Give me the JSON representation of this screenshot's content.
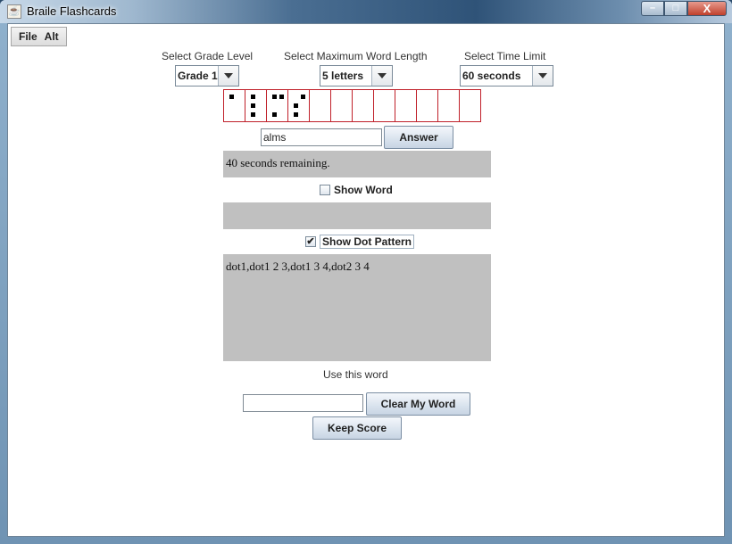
{
  "window": {
    "title": "Braile Flashcards",
    "controls": {
      "minimize": "–",
      "maximize": "□",
      "close": "X"
    }
  },
  "menu": [
    {
      "label": "File"
    },
    {
      "label": "Alt"
    }
  ],
  "options": {
    "grade": {
      "label": "Select Grade Level",
      "value": "Grade 1"
    },
    "word_length": {
      "label": "Select Maximum Word Length",
      "value": "5 letters"
    },
    "time_limit": {
      "label": "Select Time Limit",
      "value": "60 seconds"
    }
  },
  "braille": {
    "cell_count": 12,
    "cells": [
      {
        "dots": [
          1
        ]
      },
      {
        "dots": [
          1,
          2,
          3
        ]
      },
      {
        "dots": [
          1,
          3,
          4
        ]
      },
      {
        "dots": [
          2,
          3,
          4
        ]
      }
    ]
  },
  "answer": {
    "input_value": "alms",
    "button_label": "Answer"
  },
  "status": {
    "text": "40 seconds remaining."
  },
  "show_word": {
    "label": "Show Word",
    "checked": false,
    "word_text": ""
  },
  "show_dot_pattern": {
    "label": "Show Dot Pattern",
    "checked": true,
    "pattern_text": "dot1,dot1 2 3,dot1 3 4,dot2 3 4"
  },
  "use_word": {
    "label": "Use this word",
    "input_value": "",
    "clear_button_label": "Clear My Word"
  },
  "keep_score": {
    "button_label": "Keep Score"
  },
  "icons": {
    "app": "java-cup-icon",
    "dropdown": "chevron-down-icon",
    "check": "✔"
  }
}
